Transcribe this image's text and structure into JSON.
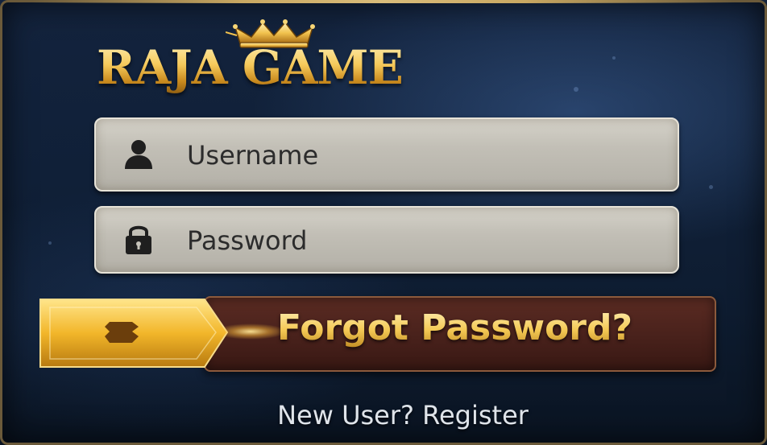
{
  "logo": {
    "text": "RAJA GAME",
    "crown_icon": "crown-icon"
  },
  "username_field": {
    "placeholder": "Username",
    "value": "",
    "icon": "user-icon"
  },
  "password_field": {
    "placeholder": "Password",
    "value": "",
    "icon": "lock-icon"
  },
  "forgot_password": {
    "label": "Forgot Password?",
    "icon": "ticket-icon"
  },
  "register_link": {
    "label": "New User? Register"
  },
  "colors": {
    "gold": "#f3c85a",
    "input_bg": "#c6c3ba",
    "banner_bg": "#4a221c",
    "background": "#102038"
  }
}
